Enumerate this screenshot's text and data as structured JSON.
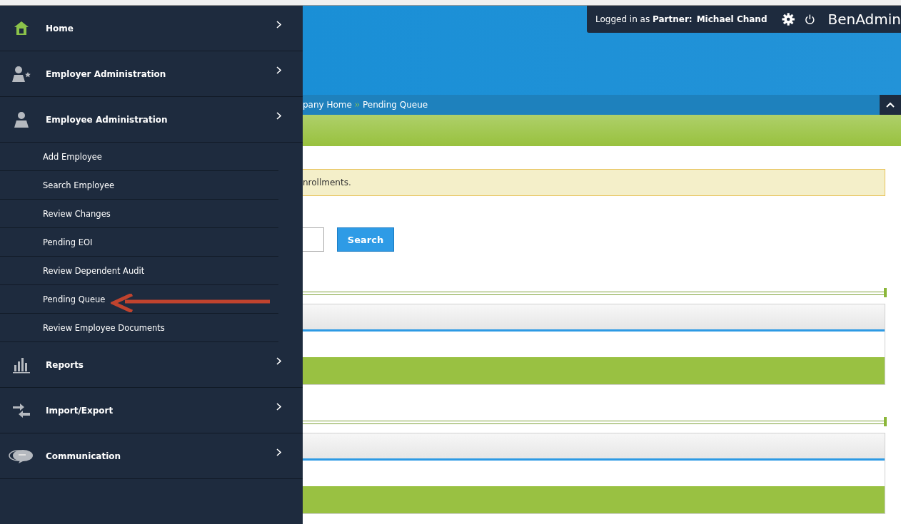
{
  "top_bar": {
    "logged_in_text": "Logged in as **Partner:**",
    "user": "Michael Chand",
    "brand": "BenAdmin"
  },
  "sidebar": {
    "items": [
      {
        "label": "Home",
        "kind": "home"
      },
      {
        "label": "Employer Administration",
        "kind": "employer"
      },
      {
        "label": "Employee Administration",
        "kind": "employee",
        "children": [
          {
            "label": "Add Employee"
          },
          {
            "label": "Search Employee"
          },
          {
            "label": "Review Changes"
          },
          {
            "label": "Pending EOI"
          },
          {
            "label": "Review Dependent Audit"
          },
          {
            "label": "Pending Queue"
          },
          {
            "label": "Review Employee Documents"
          }
        ]
      },
      {
        "label": "Reports",
        "kind": "reports"
      },
      {
        "label": "Import/Export",
        "kind": "import-export"
      },
      {
        "label": "Communication",
        "kind": "communication"
      }
    ]
  },
  "breadcrumb": [
    "pany Home",
    "Pending Queue"
  ],
  "notice": "nrollments.",
  "search_button": "Search"
}
